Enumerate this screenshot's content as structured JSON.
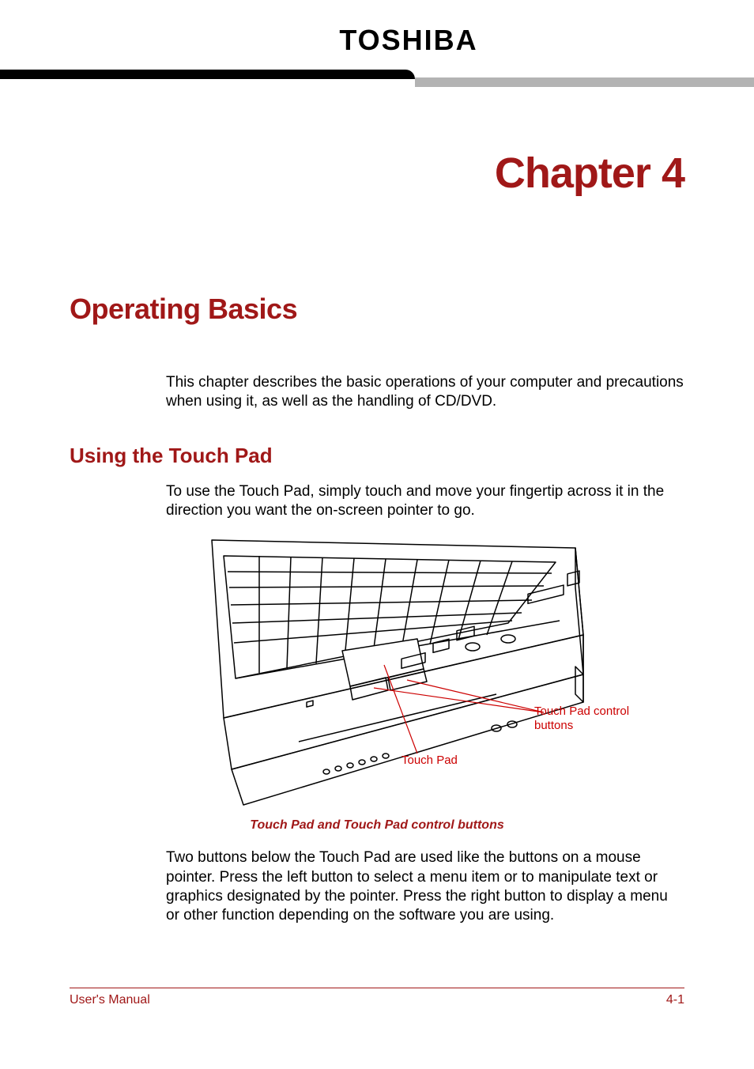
{
  "header": {
    "brand": "TOSHIBA"
  },
  "chapter": {
    "label": "Chapter 4",
    "title": "Operating Basics",
    "intro": "This chapter describes the basic operations of your computer and precautions when using it, as well as the handling of CD/DVD."
  },
  "section1": {
    "title": "Using the Touch Pad",
    "p1": "To use the Touch Pad, simply touch and move your fingertip across it in the direction you want the on-screen pointer to go.",
    "p2": "Two buttons below the Touch Pad are used like the buttons on a mouse pointer. Press the left button to select a menu item or to manipulate text or graphics designated by the pointer. Press the right button to display a menu or other function depending on the software you are using."
  },
  "figure1": {
    "label_touchpad": "Touch Pad",
    "label_buttons": "Touch Pad control buttons",
    "caption": "Touch Pad and Touch Pad control buttons"
  },
  "footer": {
    "left": "User's Manual",
    "right": "4-1"
  }
}
